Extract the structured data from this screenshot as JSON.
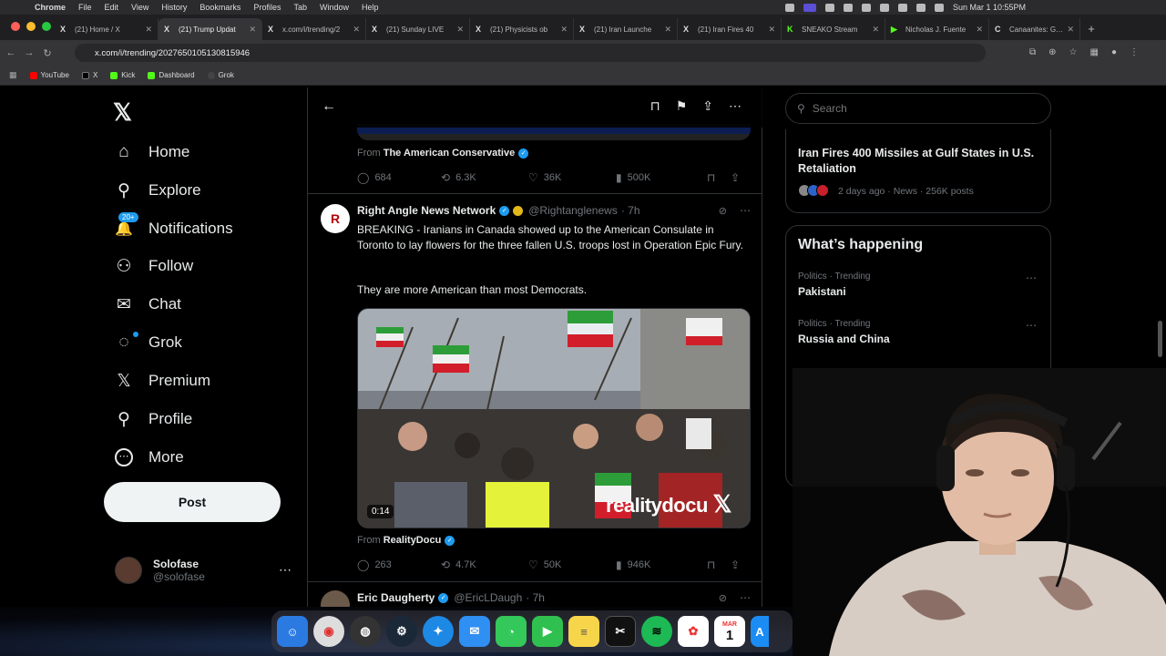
{
  "menubar": {
    "items": [
      "Chrome",
      "File",
      "Edit",
      "View",
      "History",
      "Bookmarks",
      "Profiles",
      "Tab",
      "Window",
      "Help"
    ],
    "datetime": "Sun Mar 1  10:55PM"
  },
  "tabs": [
    {
      "label": "(21) Home / X",
      "fav": "X"
    },
    {
      "label": "(21) Trump Updat",
      "fav": "X"
    },
    {
      "label": "x.com/i/trending/2",
      "fav": "X"
    },
    {
      "label": "(21) Sunday LIVE",
      "fav": "X"
    },
    {
      "label": "(21) Physicists ob",
      "fav": "X"
    },
    {
      "label": "(21) Iran Launche",
      "fav": "X"
    },
    {
      "label": "(21) Iran Fires 40",
      "fav": "X"
    },
    {
      "label": "SNEAKO Stream",
      "fav": "K"
    },
    {
      "label": "Nicholas J. Fuente",
      "fav": "▶"
    },
    {
      "label": "Canaanites: Gods",
      "fav": "C"
    }
  ],
  "address": {
    "url": "x.com/i/trending/2027650105130815946"
  },
  "bookmarks": [
    {
      "label": "YouTube",
      "color": "#ff0000"
    },
    {
      "label": "X",
      "color": "#000000"
    },
    {
      "label": "Kick",
      "color": "#53fc18"
    },
    {
      "label": "Dashboard",
      "color": "#53fc18"
    },
    {
      "label": "Grok",
      "color": "#444444"
    }
  ],
  "nav": {
    "logo": "𝕏",
    "items": [
      {
        "label": "Home",
        "icon": "⌂"
      },
      {
        "label": "Explore",
        "icon": "⚲"
      },
      {
        "label": "Notifications",
        "icon": "🔔",
        "badge": "20+"
      },
      {
        "label": "Follow",
        "icon": "⚇"
      },
      {
        "label": "Chat",
        "icon": "✉"
      },
      {
        "label": "Grok",
        "icon": "◌"
      },
      {
        "label": "Premium",
        "icon": "𝕏"
      },
      {
        "label": "Profile",
        "icon": "⚲"
      },
      {
        "label": "More",
        "icon": "⋯"
      }
    ],
    "post_label": "Post",
    "profile": {
      "name": "Solofase",
      "handle": "@solofase"
    }
  },
  "feed": {
    "prev_tweet": {
      "from": "From",
      "source": "The American Conservative",
      "replies": "684",
      "reposts": "6.3K",
      "likes": "36K",
      "views": "500K"
    },
    "tweet1": {
      "name": "Right Angle News Network",
      "handle": "@Rightanglenews",
      "time": "· 7h",
      "text1": "BREAKING - Iranians in Canada showed up to the American Consulate in Toronto to lay flowers for the three fallen U.S. troops lost in Operation Epic Fury.",
      "text2": "They are more American than most Democrats.",
      "duration": "0:14",
      "watermark": "realitydocu",
      "from": "From",
      "source": "RealityDocu",
      "replies": "263",
      "reposts": "4.7K",
      "likes": "50K",
      "views": "946K"
    },
    "tweet2": {
      "name": "Eric Daugherty",
      "handle": "@EricLDaugh",
      "time": "· 7h"
    }
  },
  "sidebar": {
    "search_placeholder": "Search",
    "trend": {
      "title": "Iran Fires 400 Missiles at Gulf States in U.S. Retaliation",
      "meta": "2 days ago · News · 256K posts"
    },
    "happening": {
      "title": "What’s happening",
      "items": [
        {
          "category": "Politics · Trending",
          "name": "Pakistani"
        },
        {
          "category": "Politics · Trending",
          "name": "Russia and China"
        }
      ]
    }
  },
  "dock": {
    "apps": [
      {
        "name": "Finder",
        "color": "#2a7ae2"
      },
      {
        "name": "Chrome",
        "color": "#dddddd"
      },
      {
        "name": "OBS",
        "color": "#333333"
      },
      {
        "name": "Steam",
        "color": "#1b2838"
      },
      {
        "name": "Safari",
        "color": "#1e88e5"
      },
      {
        "name": "Mail",
        "color": "#2f8ff2"
      },
      {
        "name": "Messages",
        "color": "#34c759"
      },
      {
        "name": "FaceTime",
        "color": "#30c04f"
      },
      {
        "name": "Notes",
        "color": "#f7d54a"
      },
      {
        "name": "CapCut",
        "color": "#111111"
      },
      {
        "name": "Spotify",
        "color": "#1db954"
      },
      {
        "name": "Photos",
        "color": "#ffffff"
      },
      {
        "name": "Calendar",
        "color": "#ffffff",
        "label": "1"
      },
      {
        "name": "App Store",
        "color": "#1c8cf5"
      }
    ],
    "calendar_month": "MAR"
  }
}
